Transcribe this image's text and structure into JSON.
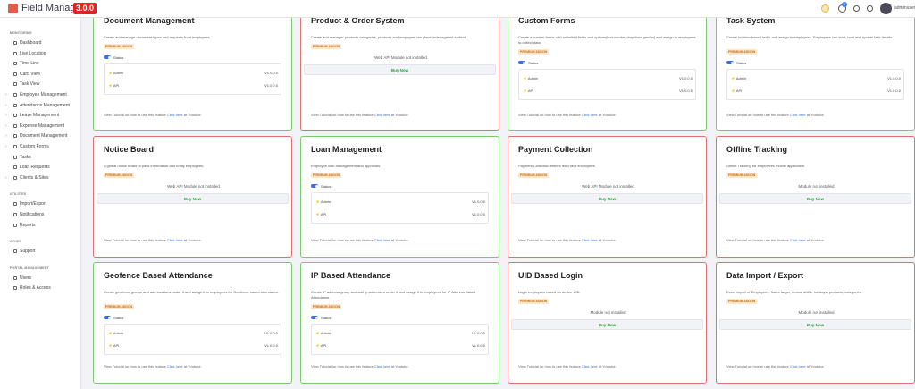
{
  "app": {
    "name": "Field Manager",
    "version": "3.0.0",
    "user": "adminuser",
    "notification_count": "1"
  },
  "sidebar": {
    "sections": [
      {
        "title": "MONITORING",
        "items": [
          {
            "label": "Dashboard",
            "expandable": false
          },
          {
            "label": "Live Location",
            "expandable": false
          },
          {
            "label": "Time Line",
            "expandable": false
          },
          {
            "label": "Card View",
            "expandable": false
          },
          {
            "label": "Task View",
            "expandable": false
          },
          {
            "label": "Employee Management",
            "expandable": true
          },
          {
            "label": "Attendance Management",
            "expandable": true
          },
          {
            "label": "Leave Management",
            "expandable": true
          },
          {
            "label": "Expense Management",
            "expandable": true
          },
          {
            "label": "Document Management",
            "expandable": true
          },
          {
            "label": "Custom Forms",
            "expandable": true
          },
          {
            "label": "Tasks",
            "expandable": false
          },
          {
            "label": "Loan Requests",
            "expandable": false
          },
          {
            "label": "Clients & Sites",
            "expandable": true
          }
        ]
      },
      {
        "title": "UTILITIES",
        "items": [
          {
            "label": "Import/Export",
            "expandable": false
          },
          {
            "label": "Notifications",
            "expandable": false
          },
          {
            "label": "Reports",
            "expandable": false
          }
        ]
      },
      {
        "title": "OTHER",
        "items": [
          {
            "label": "Support",
            "expandable": false
          }
        ]
      },
      {
        "title": "PORTAL MANAGEMENT",
        "items": [
          {
            "label": "Users",
            "expandable": false
          },
          {
            "label": "Roles & Access",
            "expandable": false
          }
        ]
      }
    ]
  },
  "common": {
    "premium": "PREMIUM ADDON",
    "status": "Status",
    "admin": "Admin",
    "api": "API",
    "buy_now": "Buy Now",
    "tutorial_prefix": "View Tutorial on how to use this feature",
    "tutorial_link": "Click here",
    "tutorial_suffix": "at Youtube."
  },
  "cards": [
    {
      "title": "Document Management",
      "desc": "Create and manage document types and requests from employees.",
      "border": "green",
      "state": "installed",
      "admin_version": "V1.0.0.0",
      "api_version": "V1.0.0.0"
    },
    {
      "title": "Product & Order System",
      "desc": "Create and manager products categories, products and employee can place order against a client.",
      "border": "red",
      "state": "web_api_missing",
      "notice": "Web API Module not installed"
    },
    {
      "title": "Custom Forms",
      "desc": "Create a custom forms with unlimited fields and options(text,number,dropdown,yes/no) and assign to employees to collect data.",
      "border": "green",
      "state": "installed",
      "admin_version": "V1.0.0.0",
      "api_version": "V1.0.0.0"
    },
    {
      "title": "Task System",
      "desc": "Create location based tasks and assign to employees. Employees can start, hold and update task details.",
      "border": "green",
      "state": "installed",
      "admin_version": "V1.0.0.0",
      "api_version": "V1.0.0.0"
    },
    {
      "title": "Notice Board",
      "desc": "A global notice board to pass information and notify employees.",
      "border": "red",
      "state": "web_api_missing",
      "notice": "Web API Module not installed"
    },
    {
      "title": "Loan Management",
      "desc": "Employee loan management and approvals.",
      "border": "green",
      "state": "installed",
      "admin_version": "V1.0.0.0",
      "api_version": "V1.0.0.0"
    },
    {
      "title": "Payment Collection",
      "desc": "Payment Collection entries from field employees.",
      "border": "red",
      "state": "web_api_missing",
      "notice": "Web API Module not installed"
    },
    {
      "title": "Offline Tracking",
      "desc": "Offline Tracking for employees mobile application.",
      "border": "red",
      "state": "not_installed",
      "notice": "Module not installed"
    },
    {
      "title": "Geofence Based Attendance",
      "desc": "Create geofence groups and add locations under it and assign it to employees for Geofence based attendance.",
      "border": "green",
      "state": "installed",
      "admin_version": "V1.0.0.0",
      "api_version": "V1.0.0.0"
    },
    {
      "title": "IP Based Attendance",
      "desc": "Create IP address group and add ip addresses under it and assign it to employees for IP Address Based Attendance.",
      "border": "green",
      "state": "installed",
      "admin_version": "V1.0.0.0",
      "api_version": "V1.0.0.0"
    },
    {
      "title": "UID Based Login",
      "desc": "Login employees based on device UID.",
      "border": "red",
      "state": "not_installed",
      "notice": "Module not installed"
    },
    {
      "title": "Data Import / Export",
      "desc": "Excel import of Employees, Sales target, teams, shifts, holidays, products, categories.",
      "border": "red",
      "state": "not_installed",
      "notice": "Module not installed"
    }
  ],
  "colors": {
    "installed_border": "#7ac96e",
    "missing_border": "#e07070",
    "buy_now": "#2a9d40",
    "version_badge": "#e02424",
    "toggle": "#3a6fe0"
  }
}
